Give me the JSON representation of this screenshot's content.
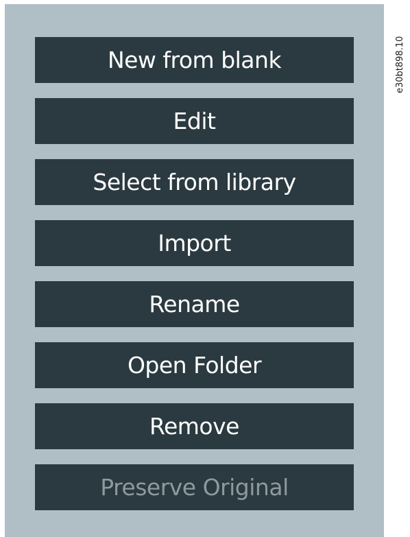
{
  "menu": {
    "items": [
      {
        "label": "New from blank",
        "enabled": true
      },
      {
        "label": "Edit",
        "enabled": true
      },
      {
        "label": "Select from library",
        "enabled": true
      },
      {
        "label": "Import",
        "enabled": true
      },
      {
        "label": "Rename",
        "enabled": true
      },
      {
        "label": "Open Folder",
        "enabled": true
      },
      {
        "label": "Remove",
        "enabled": true
      },
      {
        "label": "Preserve Original",
        "enabled": false
      }
    ]
  },
  "figure_code": "e30bt898.10",
  "colors": {
    "panel_background": "#b0bec6",
    "button_background": "#2b3a40",
    "button_text": "#ffffff",
    "disabled_text": "#8e9aa0"
  }
}
